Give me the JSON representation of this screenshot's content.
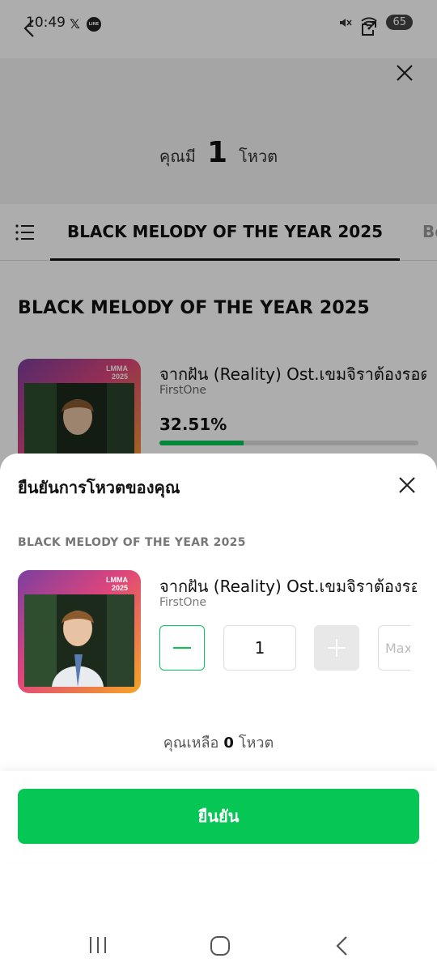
{
  "status_bar": {
    "time": "10:49",
    "battery": "65"
  },
  "header": {
    "votes_label": "คุณมี",
    "votes_count": "1",
    "votes_unit": "โหวต"
  },
  "tabs": {
    "active": "BLACK MELODY OF THE YEAR 2025",
    "next": "Be"
  },
  "category_title": "BLACK MELODY OF THE YEAR 2025",
  "thumbnail": {
    "logo_line1": "LMMA",
    "logo_line2": "2025"
  },
  "song": {
    "title": "จากฝัน (Reality) Ost.เขมจิราต้องรอด",
    "artist": "FirstOne",
    "percent": "32.51%",
    "percent_value": 32.51
  },
  "sheet": {
    "title": "ยืนยันการโหวตของคุณ",
    "category": "BLACK MELODY OF THE YEAR 2025",
    "quantity": "1",
    "max_label": "Max",
    "remaining_label": "คุณเหลือ",
    "remaining_count": "0",
    "remaining_unit": "โหวต",
    "confirm_label": "ยืนยัน"
  },
  "colors": {
    "accent": "#06c755",
    "overlay": "rgba(0,0,0,0.32)"
  }
}
